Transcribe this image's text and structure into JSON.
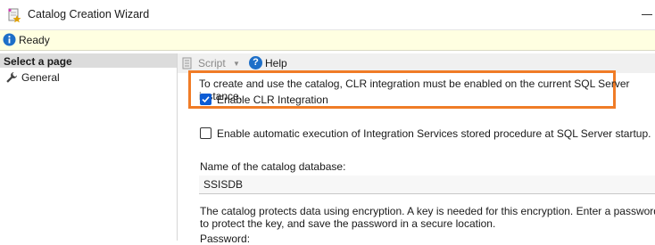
{
  "window": {
    "title": "Catalog Creation Wizard"
  },
  "status": {
    "text": "Ready"
  },
  "sidebar": {
    "header": "Select a page",
    "items": [
      {
        "label": "General",
        "icon": "wrench-icon"
      }
    ]
  },
  "toolbar": {
    "script_label": "Script",
    "help_label": "Help"
  },
  "content": {
    "clr_note": "To create and use the catalog, CLR integration must be enabled on the current SQL Server instance.",
    "enable_clr": {
      "label": "Enable CLR Integration",
      "checked": true
    },
    "auto_exec": {
      "label": "Enable automatic execution of Integration Services stored procedure at SQL Server startup.",
      "checked": false
    },
    "db_name_label": "Name of the catalog database:",
    "db_name_value": "SSISDB",
    "encryption_note": "The catalog protects data using encryption. A key is needed for this encryption. Enter a password to protect the key, and save the password in a secure location.",
    "password_label": "Password:"
  },
  "colors": {
    "highlight": "#f07c27",
    "checkbox_accent": "#0b5cd5",
    "status_bg": "#ffffe1"
  }
}
